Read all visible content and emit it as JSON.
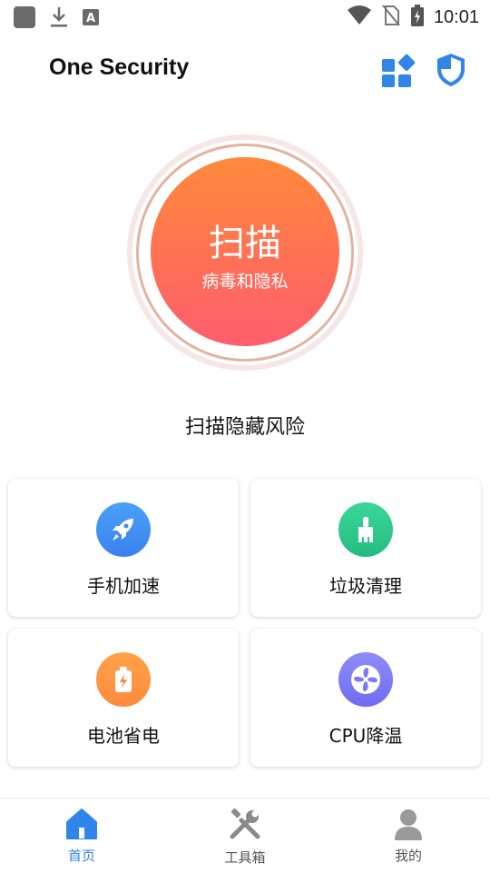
{
  "status_bar": {
    "time": "10:01",
    "left_icons": [
      "app-square-icon",
      "download-icon",
      "keyboard-a-icon"
    ],
    "right_icons": [
      "wifi-icon",
      "no-sim-icon",
      "battery-charging-icon"
    ]
  },
  "header": {
    "title": "One Security",
    "actions": [
      "apps-grid-icon",
      "shield-icon"
    ],
    "accent": "#2f86e8"
  },
  "scan": {
    "title": "扫描",
    "subtitle": "病毒和隐私",
    "caption": "扫描隐藏风险",
    "gradient": [
      "#ff8a3c",
      "#ff5e6e"
    ]
  },
  "features": [
    {
      "label": "手机加速",
      "icon": "rocket-icon",
      "color": "#3f8cf2"
    },
    {
      "label": "垃圾清理",
      "icon": "broom-icon",
      "color": "#2cc98a"
    },
    {
      "label": "电池省电",
      "icon": "battery-icon",
      "color": "#ff8a3c"
    },
    {
      "label": "CPU降温",
      "icon": "fan-icon",
      "color": "#7b79f5"
    }
  ],
  "bottom_nav": [
    {
      "label": "首页",
      "icon": "home-icon",
      "active": true
    },
    {
      "label": "工具箱",
      "icon": "tools-icon",
      "active": false
    },
    {
      "label": "我的",
      "icon": "profile-icon",
      "active": false
    }
  ],
  "colors": {
    "nav_active": "#2f86e8",
    "nav_inactive": "#9a9a9a"
  }
}
